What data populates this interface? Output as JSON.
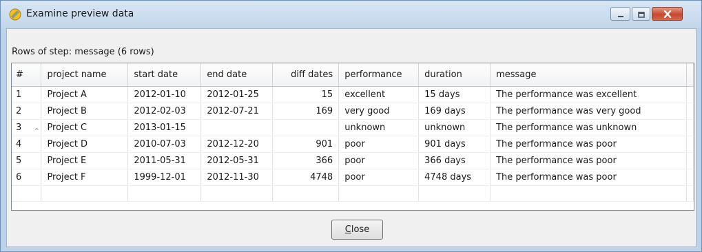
{
  "window": {
    "title": "Examine preview data"
  },
  "summary": "Rows of step: message (6 rows)",
  "table": {
    "columns": [
      "#",
      "project name",
      "start date",
      "end date",
      "diff dates",
      "performance",
      "duration",
      "message"
    ],
    "rows": [
      [
        "1",
        "Project A",
        "2012-01-10",
        "2012-01-25",
        "15",
        "excellent",
        "15 days",
        "The performance was excellent"
      ],
      [
        "2",
        "Project B",
        "2012-02-03",
        "2012-07-21",
        "169",
        "very good",
        "169 days",
        "The performance was very good"
      ],
      [
        "3",
        "Project C",
        "2013-01-15",
        "",
        "",
        "unknown",
        "unknown",
        "The performance was unknown"
      ],
      [
        "4",
        "Project D",
        "2010-07-03",
        "2012-12-20",
        "901",
        "poor",
        "901 days",
        "The performance was poor"
      ],
      [
        "5",
        "Project E",
        "2011-05-31",
        "2012-05-31",
        "366",
        "poor",
        "366 days",
        "The performance was poor"
      ],
      [
        "6",
        "Project F",
        "1999-12-01",
        "2012-11-30",
        "4748",
        "poor",
        "4748 days",
        "The performance was poor"
      ]
    ]
  },
  "buttons": {
    "close_mnemonic": "C",
    "close_rest": "lose"
  },
  "colors": {
    "titlebar": "#c8dbee",
    "close_control": "#c6482f",
    "dialog_bg": "#f0f0f0"
  }
}
